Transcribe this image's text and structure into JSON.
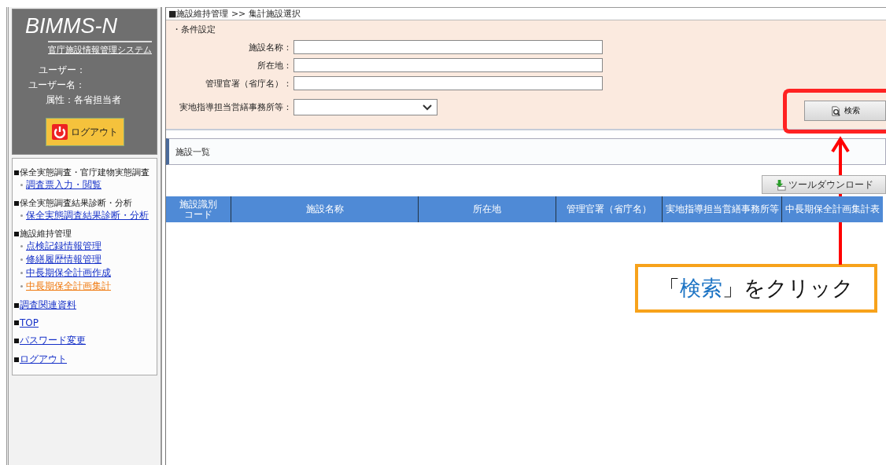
{
  "sidebar": {
    "logo": "BIMMS-N",
    "subtitle": "官庁施設情報管理システム",
    "user_info": [
      "ユーザー：",
      "ユーザー名：",
      "属性：各省担当者"
    ],
    "logout_button": "ログアウト",
    "nav": [
      {
        "kind": "heading",
        "label": "保全実態調査・官庁建物実態調査",
        "children": [
          {
            "label": "調査票入力・閲覧",
            "selected": false
          }
        ]
      },
      {
        "kind": "heading",
        "label": "保全実態調査結果診断・分析",
        "children": [
          {
            "label": "保全実態調査結果診断・分析",
            "selected": false
          }
        ]
      },
      {
        "kind": "heading",
        "label": "施設維持管理",
        "children": [
          {
            "label": "点検記録情報管理",
            "selected": false
          },
          {
            "label": "修繕履歴情報管理",
            "selected": false
          },
          {
            "label": "中長期保全計画作成",
            "selected": false
          },
          {
            "label": "中長期保全計画集計",
            "selected": true
          }
        ]
      },
      {
        "kind": "link",
        "label": "調査関連資料"
      },
      {
        "kind": "link",
        "label": "TOP"
      },
      {
        "kind": "link",
        "label": "パスワード変更"
      },
      {
        "kind": "link",
        "label": "ログアウト"
      }
    ]
  },
  "breadcrumb": "■施設維持管理 >> 集計施設選択",
  "conditions": {
    "title": "・条件設定",
    "fields": [
      {
        "kind": "text",
        "label": "施設名称："
      },
      {
        "kind": "text",
        "label": "所在地："
      },
      {
        "kind": "text",
        "label": "管理官署（省庁名）："
      },
      {
        "kind": "select",
        "label": "実地指導担当営繕事務所等："
      }
    ],
    "search_button": "検索"
  },
  "list": {
    "title": "施設一覧",
    "download_button": "ツールダウンロード",
    "columns": [
      "施設識別コード",
      "施設名称",
      "所在地",
      "管理官署（省庁名）",
      "実地指導担当営繕事務所等",
      "中長期保全計画集計表"
    ]
  },
  "callout": {
    "before": "「",
    "highlight": "検索",
    "after": "」をクリック"
  }
}
